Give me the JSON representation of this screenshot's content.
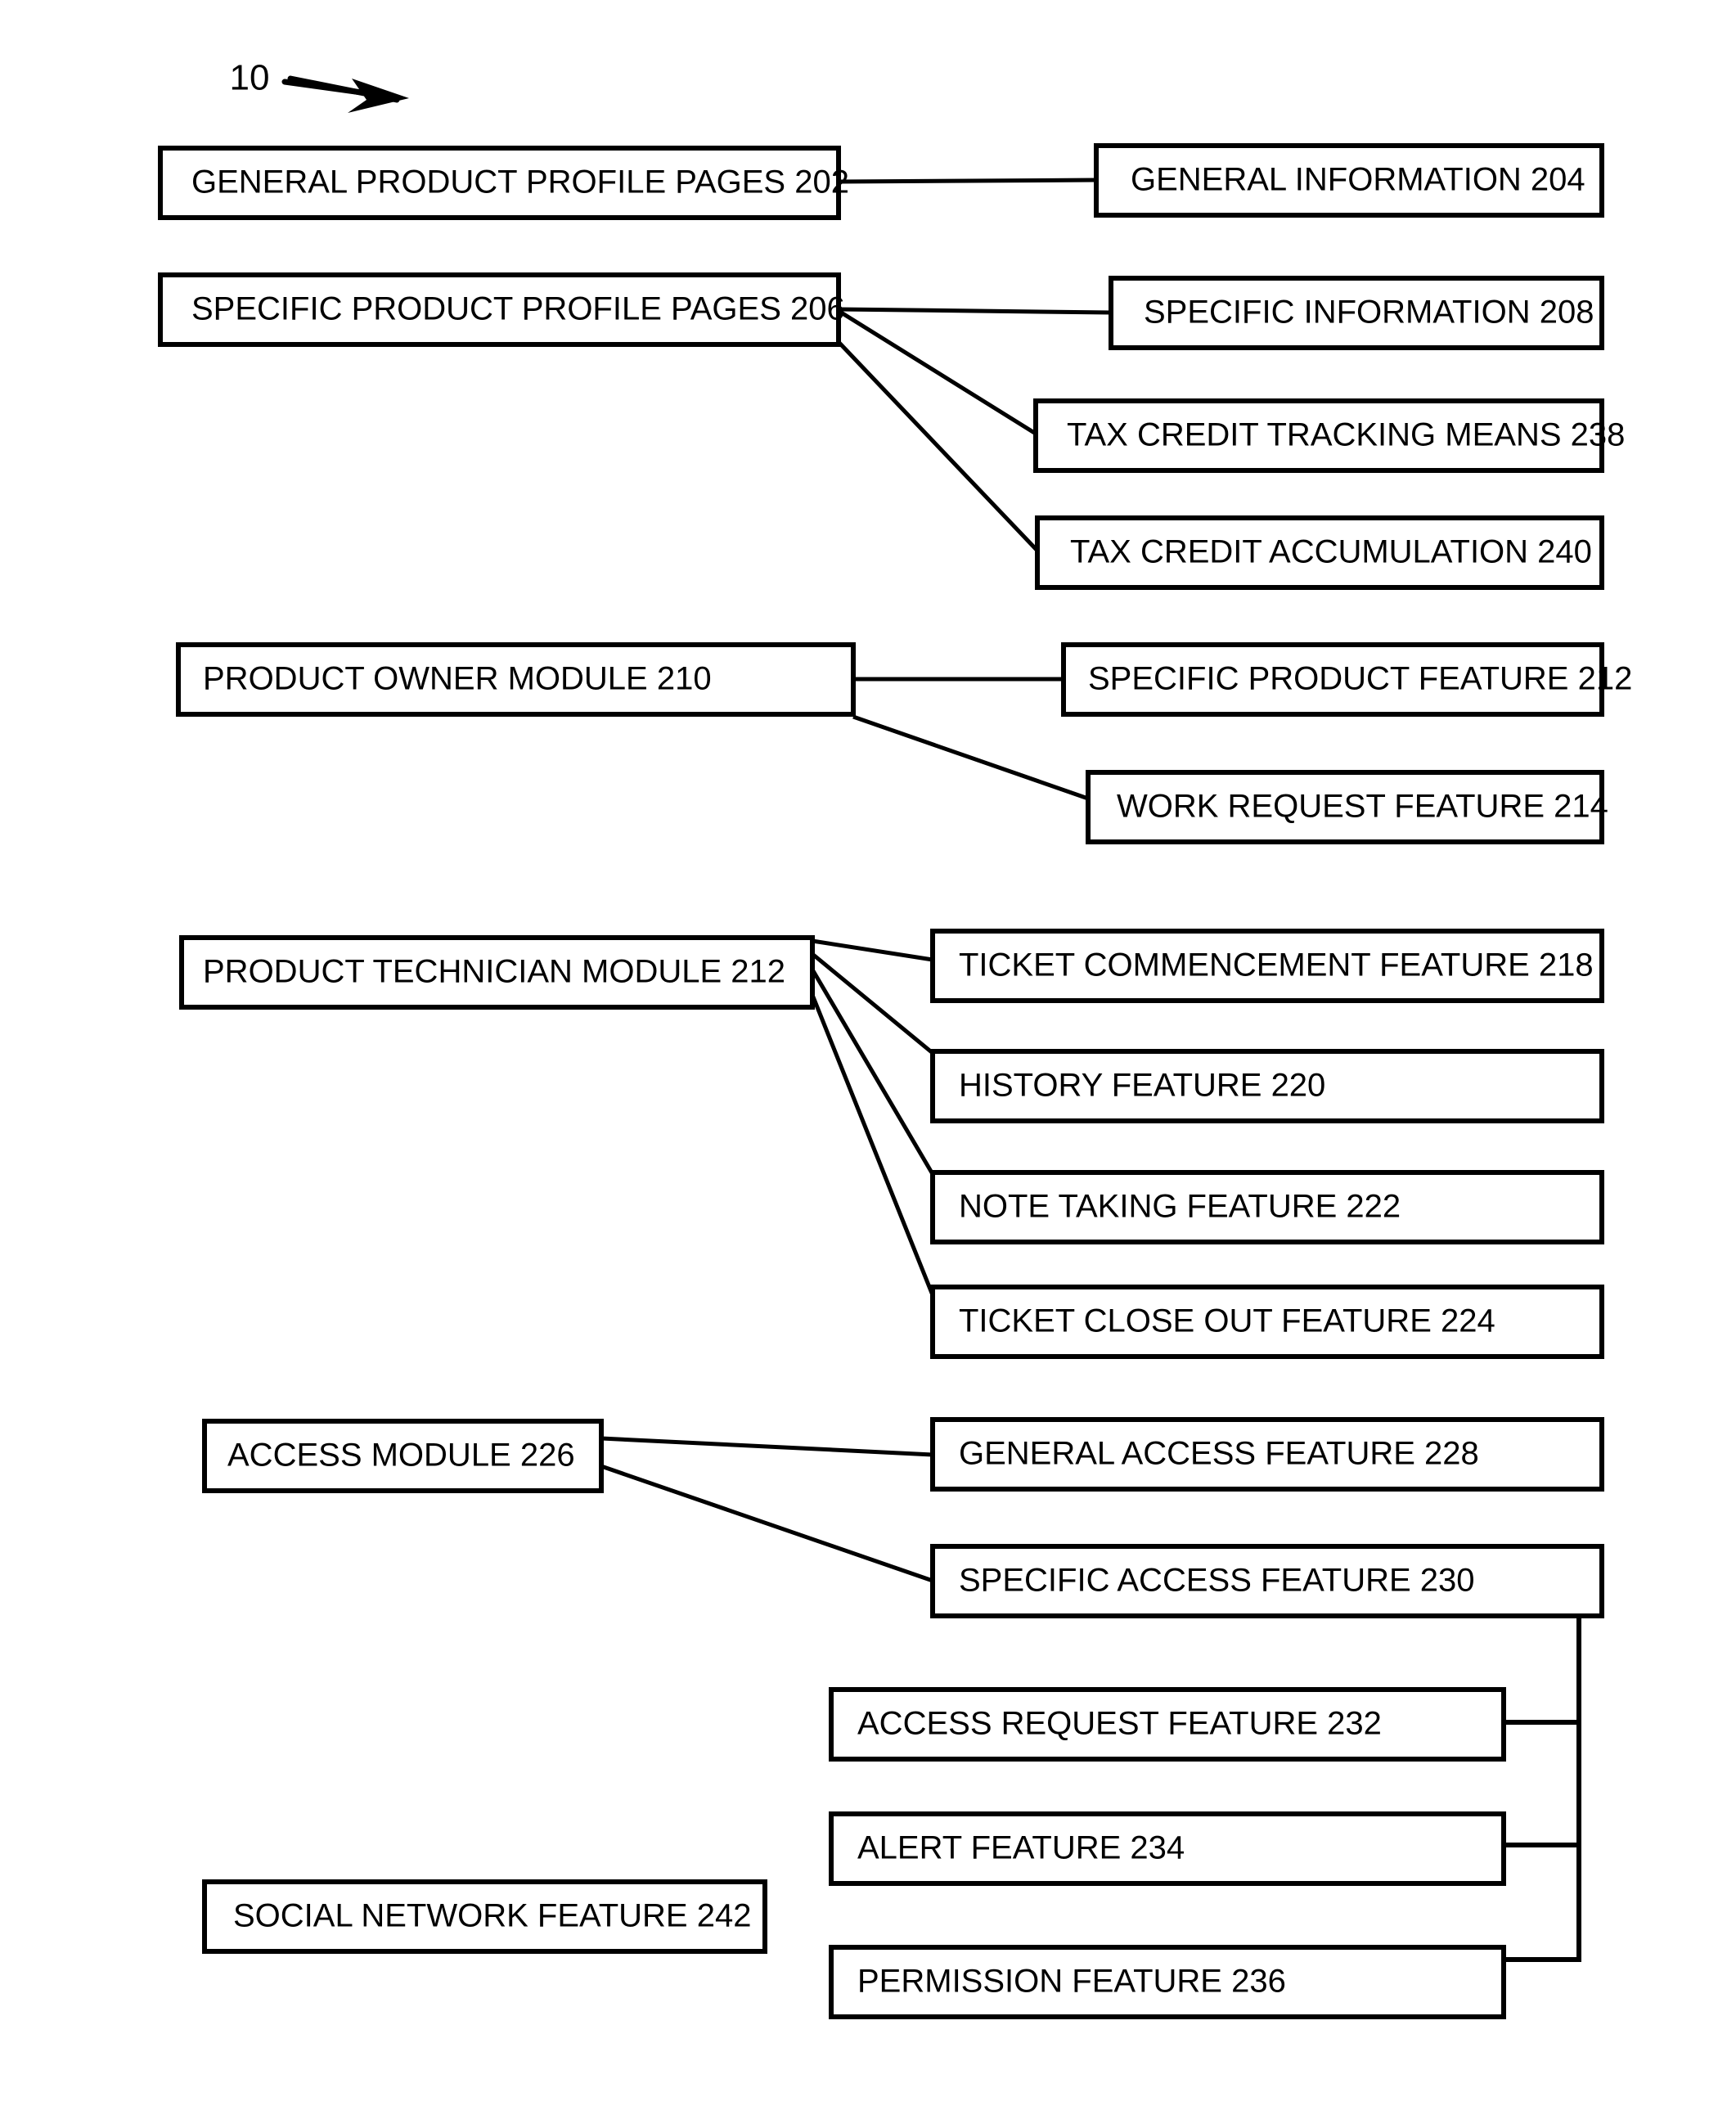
{
  "figure": {
    "reference_numeral": "10",
    "arrow_icon": "arrow-right-icon"
  },
  "nodes": {
    "general_product_profile_pages": "GENERAL PRODUCT PROFILE PAGES 202",
    "general_information": "GENERAL INFORMATION 204",
    "specific_product_profile_pages": "SPECIFIC PRODUCT PROFILE PAGES 206",
    "specific_information": "SPECIFIC INFORMATION 208",
    "tax_credit_tracking_means": "TAX CREDIT TRACKING MEANS 238",
    "tax_credit_accumulation": "TAX CREDIT ACCUMULATION 240",
    "product_owner_module": "PRODUCT OWNER MODULE 210",
    "specific_product_feature": "SPECIFIC PRODUCT FEATURE 212",
    "work_request_feature": "WORK REQUEST FEATURE 214",
    "product_technician_module": "PRODUCT TECHNICIAN MODULE 212",
    "ticket_commencement_feature": "TICKET COMMENCEMENT FEATURE 218",
    "history_feature": "HISTORY FEATURE 220",
    "note_taking_feature": "NOTE TAKING FEATURE 222",
    "ticket_close_out_feature": "TICKET CLOSE OUT FEATURE 224",
    "access_module": "ACCESS MODULE 226",
    "general_access_feature": "GENERAL ACCESS FEATURE 228",
    "specific_access_feature": "SPECIFIC ACCESS FEATURE 230",
    "access_request_feature": "ACCESS REQUEST FEATURE 232",
    "alert_feature": "ALERT FEATURE 234",
    "permission_feature": "PERMISSION FEATURE 236",
    "social_network_feature": "SOCIAL NETWORK FEATURE 242"
  },
  "colors": {
    "stroke": "#000000",
    "fill": "#ffffff",
    "background": "#ffffff"
  }
}
